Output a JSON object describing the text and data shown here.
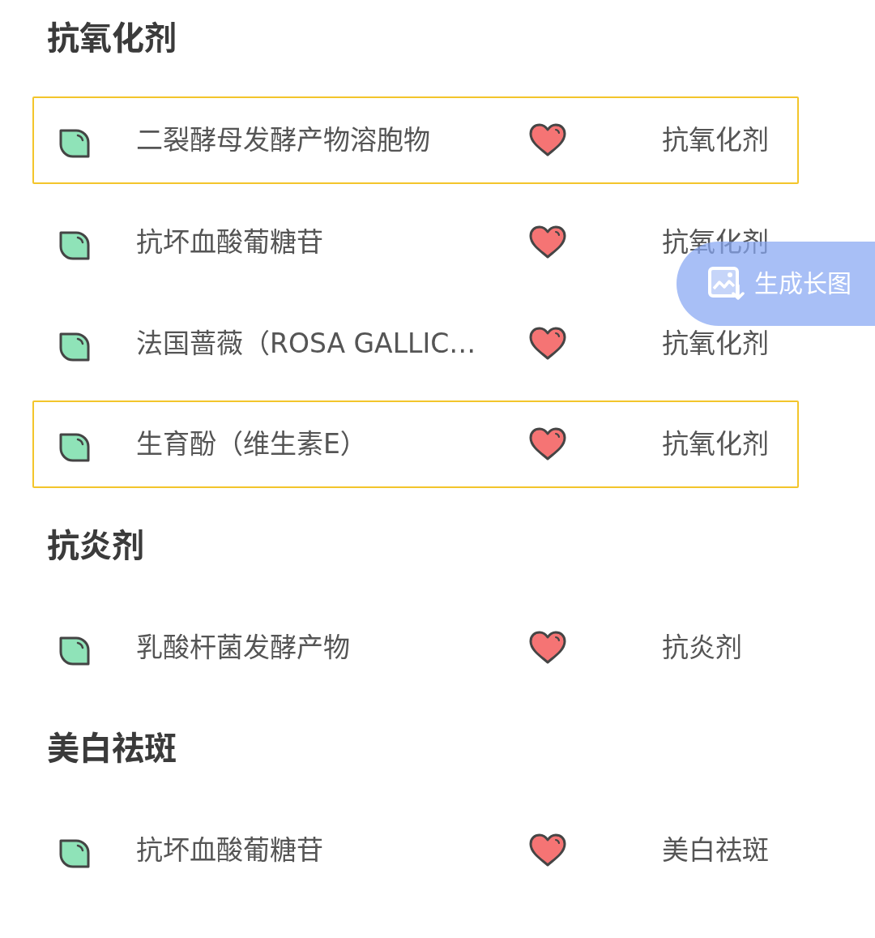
{
  "sections": [
    {
      "title": "抗氧化剂",
      "items": [
        {
          "name": "二裂酵母发酵产物溶胞物",
          "category": "抗氧化剂",
          "highlighted": true
        },
        {
          "name": "抗坏血酸葡糖苷",
          "category": "抗氧化剂",
          "highlighted": false
        },
        {
          "name": "法国蔷薇（ROSA GALLIC…",
          "category": "抗氧化剂",
          "highlighted": false
        },
        {
          "name": "生育酚（维生素E）",
          "category": "抗氧化剂",
          "highlighted": true
        }
      ]
    },
    {
      "title": "抗炎剂",
      "items": [
        {
          "name": "乳酸杆菌发酵产物",
          "category": "抗炎剂",
          "highlighted": false
        }
      ]
    },
    {
      "title": "美白祛斑",
      "items": [
        {
          "name": "抗坏血酸葡糖苷",
          "category": "美白祛斑",
          "highlighted": false
        }
      ]
    }
  ],
  "floating_button": {
    "label": "生成长图"
  }
}
